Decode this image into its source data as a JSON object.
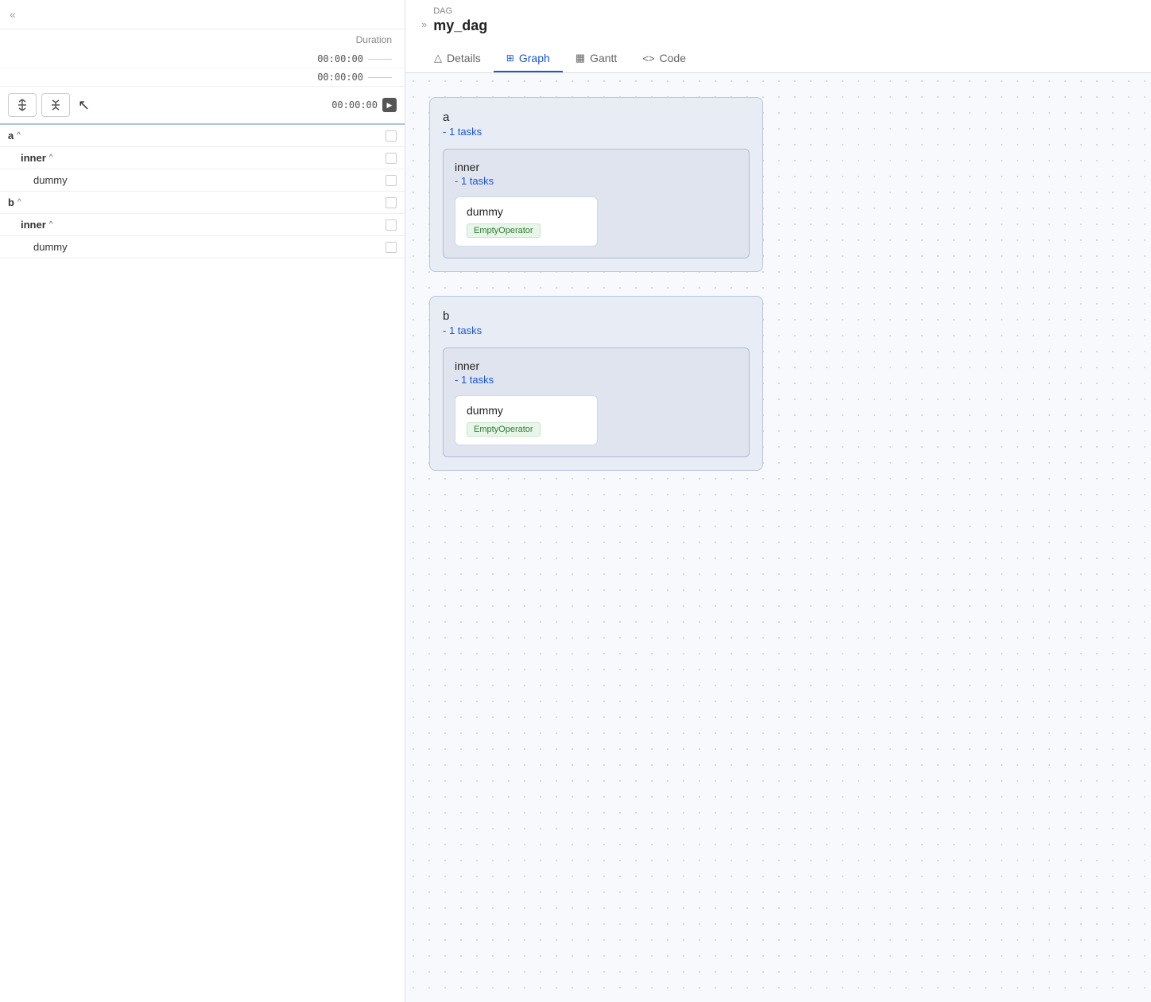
{
  "left_panel": {
    "chevron_left": "«",
    "chevron_right": "»",
    "duration_label": "Duration",
    "time_rows": [
      {
        "value": "00:00:00"
      },
      {
        "value": "00:00:00"
      },
      {
        "value": "00:00:00"
      }
    ],
    "toolbar": {
      "expand_btn_label": "expand",
      "collapse_btn_label": "collapse"
    },
    "tasks": [
      {
        "name": "a",
        "indent": 0,
        "bold": true,
        "caret": "^"
      },
      {
        "name": "inner",
        "indent": 1,
        "bold": true,
        "caret": "^"
      },
      {
        "name": "dummy",
        "indent": 2,
        "bold": false,
        "caret": ""
      },
      {
        "name": "b",
        "indent": 0,
        "bold": true,
        "caret": "^"
      },
      {
        "name": "inner",
        "indent": 1,
        "bold": true,
        "caret": "^"
      },
      {
        "name": "dummy",
        "indent": 2,
        "bold": false,
        "caret": ""
      }
    ]
  },
  "right_panel": {
    "dag_label": "DAG",
    "dag_title": "my_dag",
    "tabs": [
      {
        "id": "details",
        "label": "Details",
        "icon": "△",
        "active": false
      },
      {
        "id": "graph",
        "label": "Graph",
        "icon": "⊞",
        "active": true
      },
      {
        "id": "gantt",
        "label": "Gantt",
        "icon": "▦",
        "active": false
      },
      {
        "id": "code",
        "label": "Code",
        "icon": "<>",
        "active": false
      }
    ],
    "graph": {
      "groups": [
        {
          "id": "a",
          "title": "a",
          "subtitle": "- 1 tasks",
          "inner_groups": [
            {
              "id": "inner_a",
              "title": "inner",
              "subtitle": "- 1 tasks",
              "tasks": [
                {
                  "id": "dummy_a",
                  "title": "dummy",
                  "badge": "EmptyOperator"
                }
              ]
            }
          ]
        },
        {
          "id": "b",
          "title": "b",
          "subtitle": "- 1 tasks",
          "inner_groups": [
            {
              "id": "inner_b",
              "title": "inner",
              "subtitle": "- 1 tasks",
              "tasks": [
                {
                  "id": "dummy_b",
                  "title": "dummy",
                  "badge": "EmptyOperator"
                }
              ]
            }
          ]
        }
      ]
    }
  }
}
